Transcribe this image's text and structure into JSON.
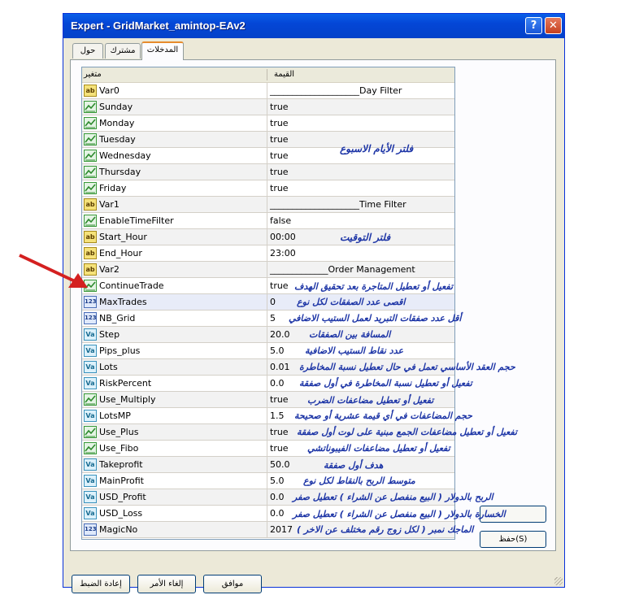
{
  "window": {
    "title": "Expert - GridMarket_amintop-EAv2"
  },
  "tabs": [
    {
      "label": "حول"
    },
    {
      "label": "مشترك"
    },
    {
      "label": "المدخلات"
    }
  ],
  "grid": {
    "header": {
      "variable": "متغير",
      "value": "القيمة"
    },
    "rows": [
      {
        "type": "ab",
        "name": "Var0",
        "value": "____________________Day Filter"
      },
      {
        "type": "bool",
        "name": "Sunday",
        "value": "true"
      },
      {
        "type": "bool",
        "name": "Monday",
        "value": "true"
      },
      {
        "type": "bool",
        "name": "Tuesday",
        "value": "true"
      },
      {
        "type": "bool",
        "name": "Wednesday",
        "value": "true"
      },
      {
        "type": "bool",
        "name": "Thursday",
        "value": "true"
      },
      {
        "type": "bool",
        "name": "Friday",
        "value": "true"
      },
      {
        "type": "ab",
        "name": "Var1",
        "value": "____________________Time Filter"
      },
      {
        "type": "bool",
        "name": "EnableTimeFilter",
        "value": "false"
      },
      {
        "type": "ab",
        "name": "Start_Hour",
        "value": "00:00"
      },
      {
        "type": "ab",
        "name": "End_Hour",
        "value": "23:00"
      },
      {
        "type": "ab",
        "name": "Var2",
        "value": "_____________Order Management"
      },
      {
        "type": "bool",
        "name": "ContinueTrade",
        "value": "true"
      },
      {
        "type": "int",
        "name": "MaxTrades",
        "value": "0"
      },
      {
        "type": "int",
        "name": "NB_Grid",
        "value": "5"
      },
      {
        "type": "dbl",
        "name": "Step",
        "value": "20.0"
      },
      {
        "type": "dbl",
        "name": "Pips_plus",
        "value": "5.0"
      },
      {
        "type": "dbl",
        "name": "Lots",
        "value": "0.01"
      },
      {
        "type": "dbl",
        "name": "RiskPercent",
        "value": "0.0"
      },
      {
        "type": "bool",
        "name": "Use_Multiply",
        "value": "true"
      },
      {
        "type": "dbl",
        "name": "LotsMP",
        "value": "1.5"
      },
      {
        "type": "bool",
        "name": "Use_Plus",
        "value": "true"
      },
      {
        "type": "bool",
        "name": "Use_Fibo",
        "value": "true"
      },
      {
        "type": "dbl",
        "name": "Takeprofit",
        "value": "50.0"
      },
      {
        "type": "dbl",
        "name": "MainProfit",
        "value": "5.0"
      },
      {
        "type": "dbl",
        "name": "USD_Profit",
        "value": "0.0"
      },
      {
        "type": "dbl",
        "name": "USD_Loss",
        "value": "0.0"
      },
      {
        "type": "int",
        "name": "MagicNo",
        "value": "2017"
      }
    ]
  },
  "icons": {
    "ab": "ab",
    "int": "123",
    "dbl": "Va"
  },
  "annotations": {
    "days": "فلتر الأيام الاسبوع",
    "time": "فلتر التوقيت",
    "continue": "تفعيل أو تعطيل المتاجرة بعد تحقيق الهدف",
    "maxtrades": "اقصى عدد الصفقات لكل نوع",
    "nbgrid": "أقل عدد صفقات التبريد لعمل الستيب الاضافي",
    "step": "المسافة بين الصفقات",
    "pips": "عدد نقاط الستيب الاضافية",
    "lots": "حجم العقد الأساسي تعمل في حال تعطيل نسبة المخاطرة",
    "risk": "تفعيل أو تعطيل نسبة المخاطرة في أول صفقة",
    "multiply": "تفعيل أو تعطيل مضاعفات الضرب",
    "lotsmp": "حجم المضاعفات في أي قيمة عشرية أو صحيحة",
    "plus": "تفعيل أو تعطيل مضاعفات الجمع مبنية على لوت أول صفقة",
    "fibo": "تفعيل أو تعطيل مضاعفات الفيبوناتشي",
    "tp": "هدف أول صفقة",
    "mainprofit": "متوسط الربح بالنقاط لكل نوع",
    "usdprofit": "الربح بالدولار ( البيع منفصل عن الشراء ) تعطيل صفر",
    "usdloss": "الخسارة بالدولار ( البيع منفصل عن الشراء ) تعطيل صفر",
    "magic": "الماجك نمبر ( لكل زوج رقم مختلف عن الاخر )"
  },
  "side_buttons": {
    "save": "حفظ(S)"
  },
  "buttons": {
    "ok": "موافق",
    "cancel": "إلغاء الأمر",
    "reset": "إعادة الضبط"
  },
  "colors": {
    "annotation": "#1d35a6",
    "arrow": "#d42020",
    "titlebar": "#0446d6"
  }
}
